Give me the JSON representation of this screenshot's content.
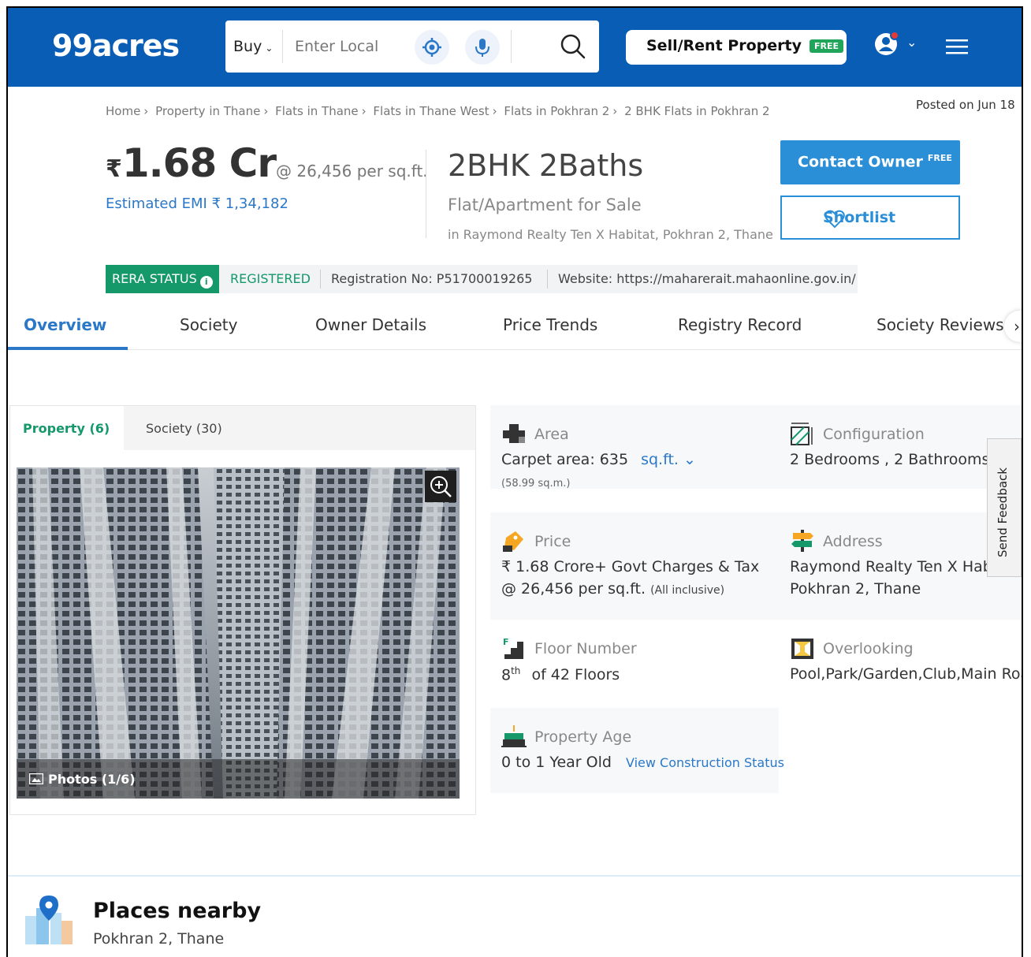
{
  "header": {
    "logo": "99acres",
    "search": {
      "buy_label": "Buy",
      "placeholder": "Enter Local"
    },
    "sell_button": "Sell/Rent Property",
    "sell_badge": "FREE",
    "colors": {
      "brand": "#0a5db5",
      "accent_green": "#15986a",
      "link_blue": "#2b78c8"
    }
  },
  "breadcrumb": {
    "items": [
      "Home",
      "Property in Thane",
      "Flats in Thane",
      "Flats in Thane West",
      "Flats in Pokhran 2",
      "2 BHK Flats in Pokhran 2"
    ],
    "separator": "›"
  },
  "posted": "Posted on Jun 18",
  "listing": {
    "currency": "₹",
    "price": "1.68 Cr",
    "per_sqft": "@ 26,456 per sq.ft.",
    "emi": "Estimated EMI ₹ 1,34,182",
    "title": "2BHK 2Baths",
    "type": "Flat/Apartment for Sale",
    "location": "in Raymond Realty Ten X Habitat, Pokhran 2, Thane",
    "contact_button": "Contact Owner",
    "contact_badge": "FREE",
    "shortlist_button": "Shortlist"
  },
  "rera": {
    "status_label": "RERA STATUS",
    "status": "REGISTERED",
    "registration": "Registration No: P51700019265",
    "website": "Website: https://maharerait.mahaonline.gov.in/"
  },
  "tabs": [
    "Overview",
    "Society",
    "Owner Details",
    "Price Trends",
    "Registry Record",
    "Society Reviews"
  ],
  "gallery": {
    "tab_property": "Property (6)",
    "tab_society": "Society (30)",
    "photos_label": "Photos (1/6)"
  },
  "details": {
    "area": {
      "label": "Area",
      "value": "Carpet area: 635",
      "unit": "sq.ft.",
      "sub": "(58.99 sq.m.)"
    },
    "configuration": {
      "label": "Configuration",
      "value": "2 Bedrooms , 2 Bathrooms"
    },
    "price": {
      "label": "Price",
      "value1": "₹ 1.68 Crore+ Govt Charges & Tax",
      "value2": "@ 26,456 per sq.ft.",
      "value2_small": "(All inclusive)"
    },
    "address": {
      "label": "Address",
      "value1": "Raymond Realty Ten X Habitat",
      "value2": "Pokhran 2, Thane"
    },
    "floor": {
      "label": "Floor Number",
      "floor": "8",
      "suffix": "th",
      "rest": "of 42 Floors"
    },
    "overlooking": {
      "label": "Overlooking",
      "value": "Pool,Park/Garden,Club,Main Road"
    },
    "age": {
      "label": "Property Age",
      "value": "0 to 1 Year Old",
      "link": "View Construction Status"
    }
  },
  "feedback": "Send Feedback",
  "places": {
    "title": "Places nearby",
    "subtitle": "Pokhran 2, Thane"
  }
}
